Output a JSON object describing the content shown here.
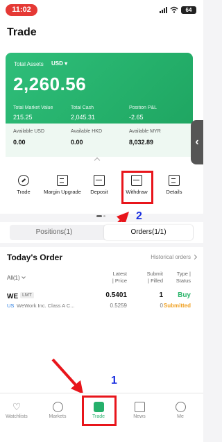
{
  "status_bar": {
    "time": "11:02",
    "battery": "64"
  },
  "header": {
    "title": "Trade"
  },
  "account": {
    "total_assets_label": "Total Assets",
    "currency": "USD ▾",
    "total_assets": "2,260.56",
    "metrics": [
      {
        "label": "Total Market Value",
        "value": "215.25"
      },
      {
        "label": "Total Cash",
        "value": "2,045.31"
      },
      {
        "label": "Position P&L",
        "value": "-2.65"
      }
    ],
    "available": [
      {
        "label": "Available USD",
        "value": "0.00"
      },
      {
        "label": "Available HKD",
        "value": "0.00"
      },
      {
        "label": "Available MYR",
        "value": "8,032.89"
      }
    ],
    "side_tab": "‹"
  },
  "actions": [
    {
      "label": "Trade"
    },
    {
      "label": "Margin Upgrade"
    },
    {
      "label": "Deposit"
    },
    {
      "label": "Withdraw"
    },
    {
      "label": "Details"
    }
  ],
  "tabs": [
    {
      "label": "Positions(1)"
    },
    {
      "label": "Orders(1/1)"
    }
  ],
  "orders": {
    "title": "Today's Order",
    "historical_link": "Historical orders",
    "filter": "All(1)",
    "columns": {
      "price": [
        "Latest",
        "| Price"
      ],
      "qty": [
        "Submit",
        "| Filled"
      ],
      "side": [
        "Type |",
        "Status"
      ]
    },
    "rows": [
      {
        "symbol": "WE",
        "order_type": "LMT",
        "market": "US",
        "name": "WeWork Inc. Class A C...",
        "price": "0.5401",
        "latest": "0.5259",
        "submit": "1",
        "filled": "0",
        "side": "Buy",
        "status": "Submitted"
      }
    ]
  },
  "bottom_nav": [
    {
      "label": "Watchlists"
    },
    {
      "label": "Markets"
    },
    {
      "label": "Trade"
    },
    {
      "label": "News"
    },
    {
      "label": "Me"
    }
  ],
  "annotations": {
    "step1": "1",
    "step2": "2"
  },
  "colors": {
    "brand_green": "#25b06b",
    "annotation_red": "#e8151b",
    "annotation_blue": "#1a2fe0",
    "status_orange": "#f0a020"
  }
}
